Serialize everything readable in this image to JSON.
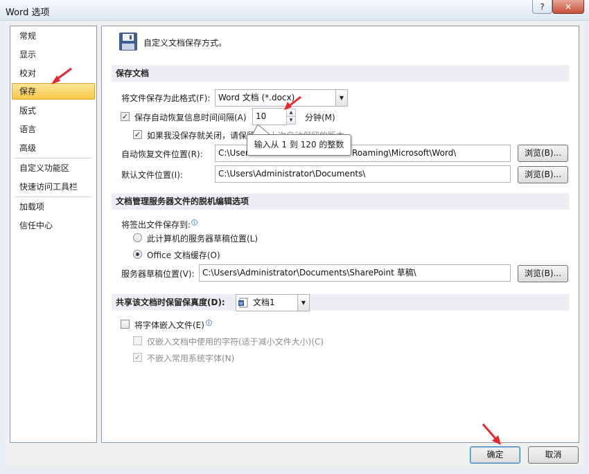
{
  "window": {
    "title": "Word 选项",
    "help": "?",
    "close": "✕"
  },
  "nav": {
    "items": [
      "常规",
      "显示",
      "校对",
      "保存",
      "版式",
      "语言",
      "高级",
      "自定义功能区",
      "快速访问工具栏",
      "加载项",
      "信任中心"
    ],
    "selected": "保存"
  },
  "header": {
    "icon": "floppy-disk-icon",
    "text": "自定义文档保存方式。"
  },
  "save_docs": {
    "section_title": "保存文档",
    "format_label": "将文件保存为此格式(F):",
    "format_value": "Word 文档 (*.docx)",
    "autorecover_label": "保存自动恢复信息时间间隔(A)",
    "autorecover_checked": true,
    "interval_value": "10",
    "minutes_label": "分钟(M)",
    "keep_last_label": "如果我没保存就关闭，请保留",
    "keep_last_tail": "上次自动保留的版本",
    "keep_last_checked": true,
    "autorecover_location_label": "自动恢复文件位置(R):",
    "autorecover_location_value_left": "C:\\Users",
    "autorecover_location_value_right": "Roaming\\Microsoft\\Word\\",
    "default_location_label": "默认文件位置(I):",
    "default_location_value": "C:\\Users\\Administrator\\Documents\\",
    "browse_label": "浏览(B)..."
  },
  "tooltip": {
    "text": "输入从 1 到 120 的整数"
  },
  "offline": {
    "section_title": "文档管理服务器文件的脱机编辑选项",
    "checkout_label": "将签出文件保存到:",
    "option_server": "此计算机的服务器草稿位置(L)",
    "option_cache": "Office 文档缓存(O)",
    "selected_option": "Office 文档缓存(O)",
    "drafts_label": "服务器草稿位置(V):",
    "drafts_value": "C:\\Users\\Administrator\\Documents\\SharePoint 草稿\\",
    "browse_label": "浏览(B)..."
  },
  "fidelity": {
    "section_title": "共享该文档时保留保真度(D):",
    "doc_value": "文档1",
    "embed_fonts_label": "将字体嵌入文件(E)",
    "embed_fonts_checked": false,
    "embed_used_only_label": "仅嵌入文档中使用的字符(适于减小文件大小)(C)",
    "embed_used_only_checked": false,
    "no_common_label": "不嵌入常用系统字体(N)",
    "no_common_checked": true
  },
  "footer": {
    "ok_label": "确定",
    "cancel_label": "取消"
  },
  "colors": {
    "selected_nav": "#f6c846",
    "annotation_arrow": "#e8262b"
  }
}
